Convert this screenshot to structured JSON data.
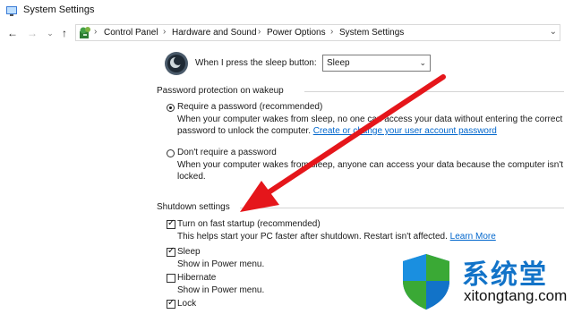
{
  "window": {
    "title": "System Settings"
  },
  "nav": {
    "back_glyph": "←",
    "forward_glyph": "→",
    "recent_glyph": "⌄",
    "up_glyph": "↑",
    "breadcrumb": [
      "Control Panel",
      "Hardware and Sound",
      "Power Options",
      "System Settings"
    ],
    "separator": "›",
    "address_dropdown_glyph": "⌄"
  },
  "sleep": {
    "label": "When I press the sleep button:",
    "selected": "Sleep",
    "chevron": "⌄"
  },
  "password": {
    "section_title": "Password protection on wakeup",
    "options": [
      {
        "label": "Require a password (recommended)",
        "selected": true,
        "desc1": "When your computer wakes from sleep, no one can access your data without entering the correct",
        "desc2_prefix": "password to unlock the computer. ",
        "link": "Create or change your user account password"
      },
      {
        "label": "Don't require a password",
        "selected": false,
        "desc1": "When your computer wakes from sleep, anyone can access your data because the computer isn't",
        "desc2": "locked."
      }
    ]
  },
  "shutdown": {
    "section_title": "Shutdown settings",
    "items": [
      {
        "label": "Turn on fast startup (recommended)",
        "checked": true,
        "desc": "This helps start your PC faster after shutdown. Restart isn't affected. ",
        "link": "Learn More"
      },
      {
        "label": "Sleep",
        "checked": true,
        "desc": "Show in Power menu."
      },
      {
        "label": "Hibernate",
        "checked": false,
        "desc": "Show in Power menu."
      },
      {
        "label": "Lock",
        "checked": true
      }
    ],
    "check_glyph": "✓"
  },
  "watermark": {
    "chinese": "系统堂",
    "url": "xitongtang.com"
  },
  "colors": {
    "link": "#0066cc",
    "arrow": "#e5161b",
    "watermark_blue": "#1273c8",
    "watermark_green": "#3aa935"
  },
  "icons": [
    "app-icon",
    "back-icon",
    "forward-icon",
    "up-icon",
    "control-panel-icon",
    "sleep-button-icon",
    "shield-logo-icon"
  ]
}
